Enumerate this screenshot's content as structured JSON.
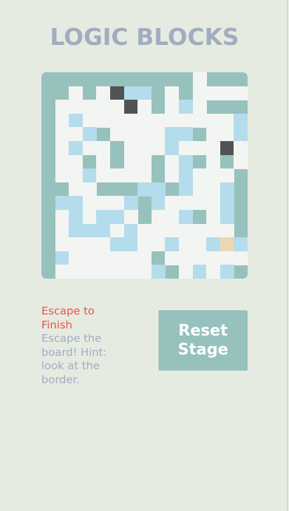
{
  "title": "LOGIC BLOCKS",
  "goal": {
    "title": "Escape to Finish",
    "description": "Escape the board! Hint: look at the border."
  },
  "reset_label": "Reset Stage",
  "colors": {
    "background": "#e5ebe1",
    "wall": "#97c1bc",
    "floor": "#f3f5f3",
    "water": "#b4dcec",
    "block": "#525355",
    "player": "#eed6b4",
    "title": "#a1adbf",
    "accent": "#e9544a"
  },
  "legend": {
    "W": "wall",
    ".": "floor",
    "b": "water",
    "D": "block",
    "P": "player"
  },
  "board_rows": [
    "WWWWWWWWWWW.WWWW",
    "WW.W.DbbW.W.....",
    "W.....D.W.b.WWW.",
    "W.b...........b.",
    "W..bW....bbW..bb",
    "W.b..W...b...D..",
    "W..W.W..W.bW.W..",
    "W..b....W.b...W.",
    "WW..WWWbbWb..bWb",
    "Wbb...bWb....bW.",
    "W.b.bb.W..bW.bW.",
    "W.bbb.b.......W.",
    "W....bb..b..bPbD",
    "Wb......W......W",
    "W.......bW.b.bWW",
    "W.W.bb..bb.b..W.",
    "W.b.....W......D",
    "W..b......b.W.W.",
    "W......W.....W.W",
    "W..........W..WW",
    "WWWWWWWWWWW.WWWW"
  ]
}
